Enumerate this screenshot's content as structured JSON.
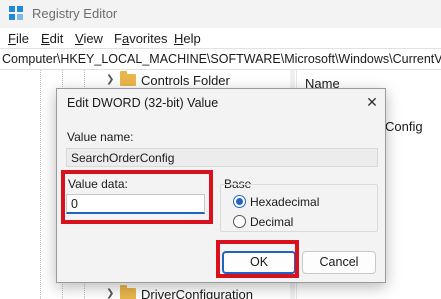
{
  "window": {
    "title": "Registry Editor"
  },
  "menu": [
    {
      "pre": "",
      "u": "F",
      "post": "ile"
    },
    {
      "pre": "",
      "u": "E",
      "post": "dit"
    },
    {
      "pre": "",
      "u": "V",
      "post": "iew"
    },
    {
      "pre": "F",
      "u": "a",
      "post": "vorites"
    },
    {
      "pre": "",
      "u": "H",
      "post": "elp"
    }
  ],
  "address": "Computer\\HKEY_LOCAL_MACHINE\\SOFTWARE\\Microsoft\\Windows\\CurrentVersion",
  "tree": {
    "items": [
      {
        "label": "Controls Folder"
      },
      {
        "label": "DriverConfiguration"
      }
    ]
  },
  "list": {
    "header": "Name",
    "value_fragment": "Config"
  },
  "dialog": {
    "title": "Edit DWORD (32-bit) Value",
    "close_glyph": "✕",
    "value_name_label": "Value name:",
    "value_name": "SearchOrderConfig",
    "value_data_label": "Value data:",
    "value_data": "0",
    "base_label": "Base",
    "base_options": [
      {
        "label": "Hexadecimal",
        "selected": true
      },
      {
        "label": "Decimal",
        "selected": false
      }
    ],
    "ok_label": "OK",
    "cancel_label": "Cancel"
  },
  "colors": {
    "highlight": "#d9101e",
    "accent": "#1f63c6",
    "folder": "#e8b64a"
  }
}
